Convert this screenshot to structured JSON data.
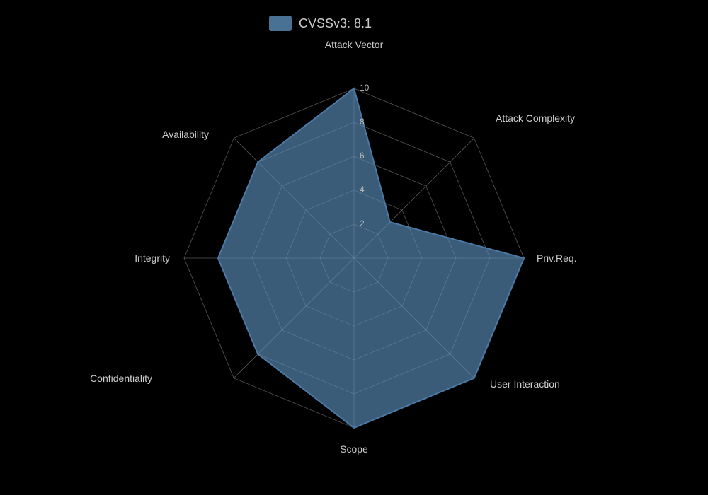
{
  "chart": {
    "title": "CVSSv3: 8.1",
    "legend_label": "CVSSv3: 8.1",
    "axes": [
      {
        "name": "Attack Vector",
        "value": 10,
        "angle_deg": 270
      },
      {
        "name": "Attack Complexity",
        "value": 3,
        "angle_deg": 321.4
      },
      {
        "name": "Priv.Req.",
        "value": 10,
        "angle_deg": 12.9
      },
      {
        "name": "User Interaction",
        "value": 10,
        "angle_deg": 64.3
      },
      {
        "name": "Scope",
        "value": 10,
        "angle_deg": 115.7
      },
      {
        "name": "Confidentiality",
        "value": 8,
        "angle_deg": 167.1
      },
      {
        "name": "Integrity",
        "value": 8,
        "angle_deg": 218.6
      },
      {
        "name": "Availability",
        "value": 8,
        "angle_deg": 244.3
      }
    ],
    "scale_labels": [
      "2",
      "4",
      "6",
      "8",
      "10"
    ],
    "max_value": 10,
    "num_rings": 5,
    "colors": {
      "fill": "#5b8db8",
      "stroke": "#4a7aa5",
      "grid": "#aaaaaa",
      "label": "#cccccc",
      "scale": "#bbbbbb"
    }
  }
}
